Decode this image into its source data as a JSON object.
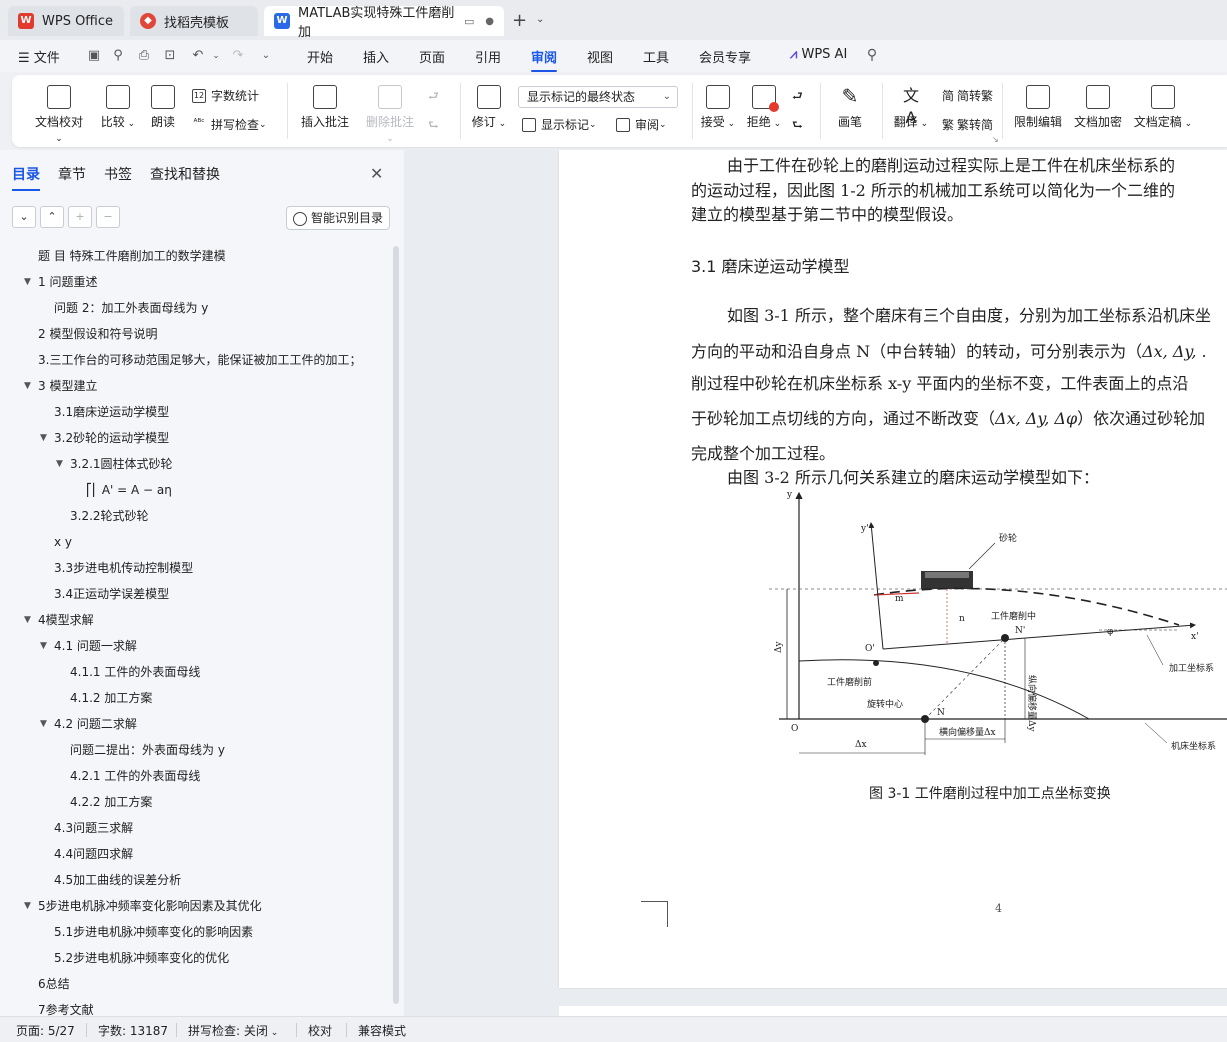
{
  "tabs": [
    {
      "label": "WPS Office"
    },
    {
      "label": "找稻壳模板"
    },
    {
      "label": "MATLAB实现特殊工件磨削加"
    }
  ],
  "menu": {
    "file": "文件",
    "items": [
      "开始",
      "插入",
      "页面",
      "引用",
      "审阅",
      "视图",
      "工具",
      "会员专享"
    ],
    "active": "审阅",
    "wps_ai": "WPS AI"
  },
  "ribbon": {
    "doc_proofread": "文档校对",
    "compare": "比较",
    "read_aloud": "朗读",
    "word_count": "字数统计",
    "spell_check": "拼写检查",
    "insert_comment": "插入批注",
    "delete_comment": "删除批注",
    "track_changes": "修订",
    "markup_dropdown": "显示标记的最终状态",
    "show_markup": "显示标记",
    "review": "审阅",
    "accept": "接受",
    "reject": "拒绝",
    "pen": "画笔",
    "translate": "翻译",
    "to_traditional": "简转繁",
    "to_simplified": "繁转简",
    "restrict_editing": "限制编辑",
    "encrypt": "文档加密",
    "finalize": "文档定稿"
  },
  "panel": {
    "tabs": [
      "目录",
      "章节",
      "书签",
      "查找和替换"
    ],
    "active_tab": "目录",
    "smart_toc": "智能识别目录",
    "toc": [
      {
        "label": "题 目 特殊工件磨削加工的数学建模",
        "level": 1,
        "arrow": ""
      },
      {
        "label": "1 问题重述",
        "level": 1,
        "arrow": "▼"
      },
      {
        "label": "问题 2：加工外表面母线为 y",
        "level": 2,
        "arrow": ""
      },
      {
        "label": "2 模型假设和符号说明",
        "level": 1,
        "arrow": ""
      },
      {
        "label": "3.三工作台的可移动范围足够大，能保证被加工工件的加工；",
        "level": 1,
        "arrow": ""
      },
      {
        "label": "3 模型建立",
        "level": 1,
        "arrow": "▼"
      },
      {
        "label": "3.1磨床逆运动学模型",
        "level": 2,
        "arrow": ""
      },
      {
        "label": "3.2砂轮的运动学模型",
        "level": 2,
        "arrow": "▼"
      },
      {
        "label": "3.2.1圆柱体式砂轮",
        "level": 3,
        "arrow": "▼"
      },
      {
        "label": "⎡⎢ A' = A  − aη",
        "level": 4,
        "arrow": ""
      },
      {
        "label": "3.2.2轮式砂轮",
        "level": 3,
        "arrow": ""
      },
      {
        "label": "x y",
        "level": 2,
        "arrow": ""
      },
      {
        "label": "3.3步进电机传动控制模型",
        "level": 2,
        "arrow": ""
      },
      {
        "label": "3.4正运动学误差模型",
        "level": 2,
        "arrow": ""
      },
      {
        "label": "4模型求解",
        "level": 1,
        "arrow": "▼"
      },
      {
        "label": "4.1 问题一求解",
        "level": 2,
        "arrow": "▼"
      },
      {
        "label": "4.1.1 工件的外表面母线",
        "level": 3,
        "arrow": ""
      },
      {
        "label": "4.1.2 加工方案",
        "level": 3,
        "arrow": ""
      },
      {
        "label": "4.2 问题二求解",
        "level": 2,
        "arrow": "▼"
      },
      {
        "label": "问题二提出：外表面母线为 y",
        "level": 3,
        "arrow": ""
      },
      {
        "label": "4.2.1 工件的外表面母线",
        "level": 3,
        "arrow": ""
      },
      {
        "label": "4.2.2 加工方案",
        "level": 3,
        "arrow": ""
      },
      {
        "label": "4.3问题三求解",
        "level": 2,
        "arrow": ""
      },
      {
        "label": "4.4问题四求解",
        "level": 2,
        "arrow": ""
      },
      {
        "label": "4.5加工曲线的误差分析",
        "level": 2,
        "arrow": ""
      },
      {
        "label": "5步进电机脉冲频率变化影响因素及其优化",
        "level": 1,
        "arrow": "▼"
      },
      {
        "label": "5.1步进电机脉冲频率变化的影响因素",
        "level": 2,
        "arrow": ""
      },
      {
        "label": "5.2步进电机脉冲频率变化的优化",
        "level": 2,
        "arrow": ""
      },
      {
        "label": "6总结",
        "level": 1,
        "arrow": ""
      },
      {
        "label": "7参考文献",
        "level": 1,
        "arrow": ""
      }
    ]
  },
  "document": {
    "lines": [
      "由于工件在砂轮上的磨削运动过程实际上是工件在机床坐标系的",
      "的运动过程，因此图 1-2 所示的机械加工系统可以简化为一个二维的",
      "建立的模型基于第二节中的模型假设。"
    ],
    "section_heading": "3.1  磨床逆运动学模型",
    "para2": [
      "如图 3-1 所示，整个磨床有三个自由度，分别为加工坐标系沿机床坐",
      "方向的平动和沿自身点 N（中台转轴）的转动，可分别表示为（",
      "削过程中砂轮在机床坐标系 x-y 平面内的坐标不变，工件表面上的点沿",
      "于砂轮加工点切线的方向，通过不断改变（",
      "完成整个加工过程。",
      "由图 3-2 所示几何关系建立的磨床运动学模型如下："
    ],
    "math1": "Δx, Δy, .",
    "math2": "Δx, Δy, Δφ",
    "math2_after": "）依次通过砂轮加",
    "figure": {
      "caption": "图 3-1  工件磨削过程中加工点坐标变换",
      "labels": {
        "y_axis": "y",
        "y_prime": "y'",
        "wheel": "砂轮",
        "m": "m",
        "n": "n",
        "middle": "工件磨削中",
        "n_prime": "N'",
        "x_prime": "x'",
        "phi": "φ",
        "o_prime": "O'",
        "dy": "Δy",
        "vertical_offset": "纵向偏移量Δy",
        "before": "工件磨削前",
        "processing_frame": "加工坐标系",
        "rotation_center": "旋转中心",
        "n_label": "N",
        "o": "O",
        "horizontal_offset": "横向偏移量Δx",
        "dx": "Δx",
        "machine_frame": "机床坐标系"
      }
    },
    "page_number": "4"
  },
  "status": {
    "page": "页面: 5/27",
    "words": "字数: 13187",
    "spell": "拼写检查: 关闭",
    "proof": "校对",
    "compat": "兼容模式"
  },
  "colors": {
    "accent": "#1a57e8",
    "wps_red": "#e23a2e"
  }
}
